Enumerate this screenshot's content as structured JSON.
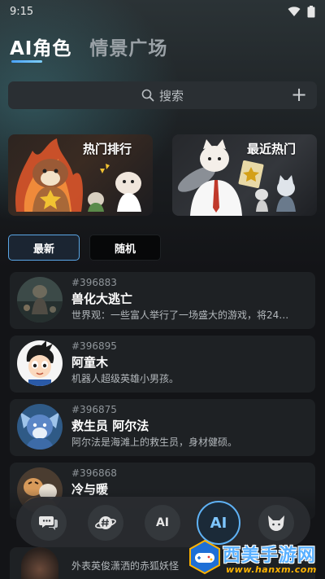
{
  "status_bar": {
    "time": "9:15"
  },
  "tabs": [
    {
      "label": "AI角色",
      "active": true
    },
    {
      "label": "情景广场",
      "active": false
    }
  ],
  "search": {
    "placeholder": "搜索",
    "add_label": "+"
  },
  "banners": [
    {
      "title": "热门排行"
    },
    {
      "title": "最近热门"
    }
  ],
  "filters": [
    {
      "label": "最新",
      "active": true
    },
    {
      "label": "随机",
      "active": false
    }
  ],
  "characters": [
    {
      "id": "#396883",
      "name": "兽化大逃亡",
      "desc": "世界观：一些富人举行了一场盛大的游戏，将24…"
    },
    {
      "id": "#396895",
      "name": "阿童木",
      "desc": "机器人超级英雄小男孩。"
    },
    {
      "id": "#396875",
      "name": "救生员 阿尔法",
      "desc": "阿尔法是海滩上的救生员，身材健硕。"
    },
    {
      "id": "#396868",
      "name": "冷与暖",
      "desc": ""
    }
  ],
  "peek_row": {
    "desc": "外表英俊潇洒的赤狐妖怪"
  },
  "bottom_nav": [
    {
      "icon": "chat-bubbles-icon",
      "label": "",
      "active": false
    },
    {
      "icon": "planet-hashtag-icon",
      "label": "",
      "active": false
    },
    {
      "icon": "ai-sparkle-icon",
      "label": "AI",
      "active": false
    },
    {
      "icon": "ai-icon",
      "label": "AI",
      "active": true
    },
    {
      "icon": "fox-icon",
      "label": "",
      "active": false
    }
  ],
  "watermark": {
    "title": "西美手游网",
    "url": "www.hanxm.com"
  },
  "colors": {
    "accent": "#5aa6e6",
    "background": "#131417",
    "card": "#1e2124"
  }
}
